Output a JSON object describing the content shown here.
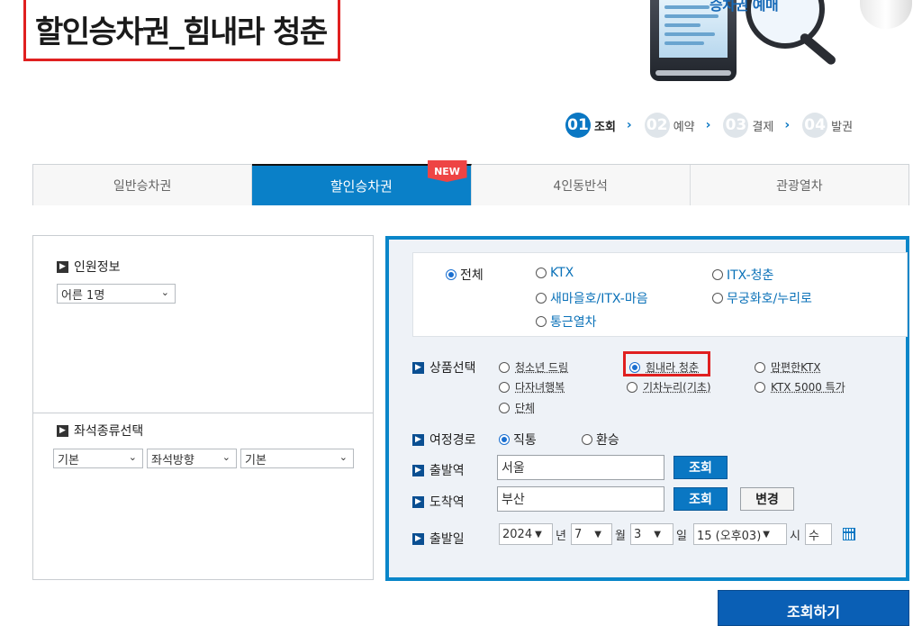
{
  "page_title": "할인승차권_힘내라 청춘",
  "banner_text": "승차권 예매",
  "steps": [
    {
      "num": "01",
      "label": "조회",
      "active": true
    },
    {
      "num": "02",
      "label": "예약",
      "active": false
    },
    {
      "num": "03",
      "label": "결제",
      "active": false
    },
    {
      "num": "04",
      "label": "발권",
      "active": false
    }
  ],
  "tabs": [
    {
      "label": "일반승차권",
      "active": false
    },
    {
      "label": "할인승차권",
      "active": true,
      "badge": "NEW"
    },
    {
      "label": "4인동반석",
      "active": false
    },
    {
      "label": "관광열차",
      "active": false
    }
  ],
  "passenger": {
    "title": "인원정보",
    "selected": "어른 1명"
  },
  "seat": {
    "title": "좌석종류선택",
    "type": "기본",
    "direction": "좌석방향",
    "detail": "기본"
  },
  "train_types": [
    {
      "label": "전체",
      "checked": true
    },
    {
      "label": "KTX",
      "checked": false
    },
    {
      "label": "ITX-청춘",
      "checked": false
    },
    {
      "label": "새마을호/ITX-마음",
      "checked": false
    },
    {
      "label": "무궁화호/누리로",
      "checked": false
    },
    {
      "label": "통근열차",
      "checked": false
    }
  ],
  "product": {
    "title": "상품선택",
    "items": [
      {
        "label": "청소년 드림",
        "checked": false
      },
      {
        "label": "힘내라 청춘",
        "checked": true
      },
      {
        "label": "맘편한KTX",
        "checked": false
      },
      {
        "label": "다자녀행복",
        "checked": false
      },
      {
        "label": "기차누리(기초)",
        "checked": false
      },
      {
        "label": "KTX 5000 특가",
        "checked": false
      },
      {
        "label": "단체",
        "checked": false
      }
    ]
  },
  "route": {
    "title": "여정경로",
    "options": [
      {
        "label": "직통",
        "checked": true
      },
      {
        "label": "환승",
        "checked": false
      }
    ]
  },
  "departure": {
    "title": "출발역",
    "value": "서울",
    "search_label": "조회"
  },
  "arrival": {
    "title": "도착역",
    "value": "부산",
    "search_label": "조회",
    "swap_label": "변경"
  },
  "date": {
    "title": "출발일",
    "year": "2024",
    "year_unit": "년",
    "month": "7",
    "month_unit": "월",
    "day": "3",
    "day_unit": "일",
    "hour": "15 (오후03)",
    "hour_unit": "시",
    "weekday": "수"
  },
  "submit_label": "조회하기",
  "colors": {
    "accent": "#0a80c8",
    "highlight": "#e02020",
    "panel_border": "#0a86c9"
  }
}
